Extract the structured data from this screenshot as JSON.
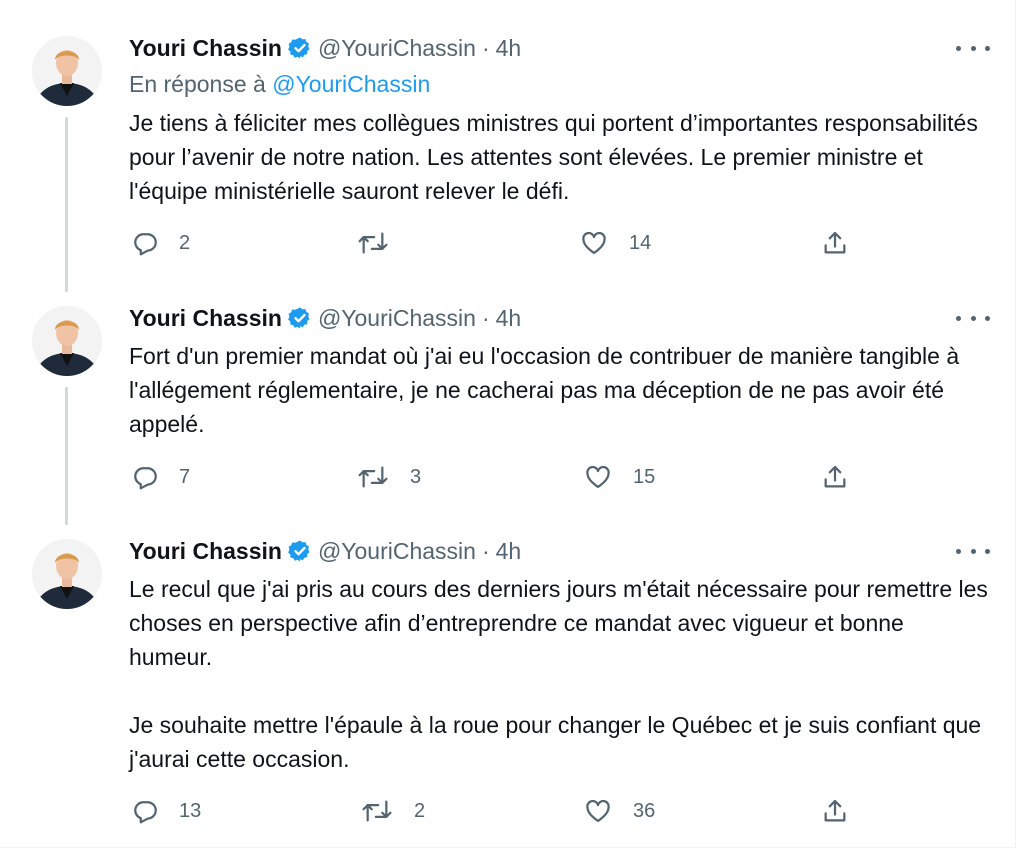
{
  "tweets": [
    {
      "author_name": "Youri Chassin",
      "handle": "@YouriChassin",
      "separator": "·",
      "time": "4h",
      "reply_prefix": "En réponse à",
      "reply_handle": "@YouriChassin",
      "paragraphs": [
        "Je tiens à féliciter mes collègues ministres qui portent d’importantes responsabilités pour l’avenir de notre nation. Les attentes sont élevées. Le premier ministre et l'équipe ministérielle sauront relever le défi."
      ],
      "replies": "2",
      "retweets": "",
      "likes": "14"
    },
    {
      "author_name": "Youri Chassin",
      "handle": "@YouriChassin",
      "separator": "·",
      "time": "4h",
      "paragraphs": [
        "Fort d'un premier mandat où j'ai eu l'occasion de contribuer de manière tangible à l'allégement réglementaire, je ne cacherai pas ma déception de ne pas avoir été appelé."
      ],
      "replies": "7",
      "retweets": "3",
      "likes": "15"
    },
    {
      "author_name": "Youri Chassin",
      "handle": "@YouriChassin",
      "separator": "·",
      "time": "4h",
      "paragraphs": [
        "Le recul que j'ai pris au cours des derniers jours m'était nécessaire pour remettre les choses en perspective afin d’entreprendre ce mandat avec vigueur et bonne humeur.",
        "Je souhaite mettre l'épaule à la roue pour changer le Québec et je suis confiant que j'aurai cette occasion."
      ],
      "replies": "13",
      "retweets": "2",
      "likes": "36"
    }
  ],
  "colors": {
    "text": "#0f1419",
    "secondary": "#536471",
    "accent": "#1d9bf0",
    "thread_line": "#cfd9de"
  },
  "icons": [
    "verified-badge-icon",
    "more-icon",
    "reply-icon",
    "retweet-icon",
    "like-icon",
    "share-icon"
  ]
}
